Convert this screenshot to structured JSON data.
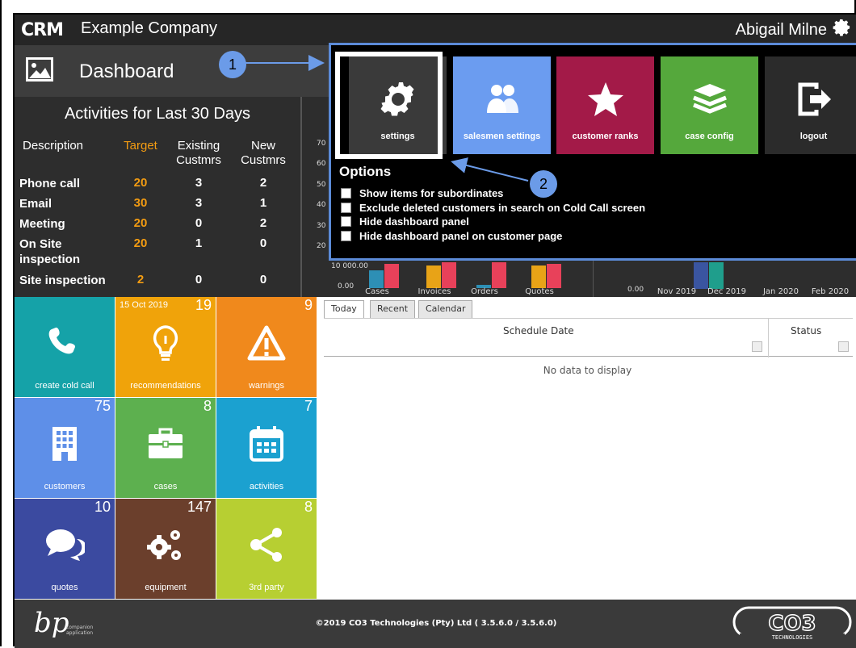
{
  "topbar": {
    "logo": "CRM",
    "company": "Example Company",
    "user": "Abigail Milne",
    "gear_icon": "gear-icon"
  },
  "titlebar": {
    "title": "Dashboard",
    "icon": "image-icon"
  },
  "activities": {
    "title": "Activities for Last 30 Days",
    "headers": {
      "description": "Description",
      "target": "Target",
      "existing": "Existing\nCustmrs",
      "new": "New\nCustmrs"
    },
    "rows": [
      {
        "description": "Phone call",
        "target": "20",
        "existing": "3",
        "new": "2"
      },
      {
        "description": "Email",
        "target": "30",
        "existing": "3",
        "new": "1"
      },
      {
        "description": "Meeting",
        "target": "20",
        "existing": "0",
        "new": "2"
      },
      {
        "description": "On Site\ninspection",
        "target": "20",
        "existing": "1",
        "new": "0"
      },
      {
        "description": "Site inspection",
        "target": "2",
        "existing": "0",
        "new": "0"
      }
    ]
  },
  "chart_data": [
    {
      "type": "bar",
      "categories": [
        "Cases",
        "Invoices",
        "Orders",
        "Quotes"
      ],
      "y_tick_labels": [
        "70",
        "60",
        "50",
        "40",
        "30",
        "20",
        "10 000.00",
        "0.00"
      ],
      "series_colors": [
        "#2d8fb5",
        "#e8a317",
        "#e8415a"
      ]
    },
    {
      "type": "bar",
      "categories": [
        "Nov 2019",
        "Dec 2019",
        "Jan 2020",
        "Feb 2020"
      ],
      "y_tick_labels": [
        "0.00"
      ],
      "series_colors": [
        "#3a55a0",
        "#1f9e8c"
      ]
    }
  ],
  "tiles": [
    {
      "label": "create cold call",
      "count": "",
      "date": "",
      "color": "#15a2a8",
      "icon": "phone-icon"
    },
    {
      "label": "recommendations",
      "count": "19",
      "date": "15 Oct 2019",
      "color": "#f0a30a",
      "icon": "lightbulb-icon"
    },
    {
      "label": "warnings",
      "count": "9",
      "date": "",
      "color": "#f0891c",
      "icon": "warning-icon"
    },
    {
      "label": "customers",
      "count": "75",
      "date": "",
      "color": "#5e8fe8",
      "icon": "building-icon"
    },
    {
      "label": "cases",
      "count": "8",
      "date": "",
      "color": "#5db04f",
      "icon": "briefcase-icon"
    },
    {
      "label": "activities",
      "count": "7",
      "date": "",
      "color": "#1ba1d0",
      "icon": "calendar-icon"
    },
    {
      "label": "quotes",
      "count": "10",
      "date": "",
      "color": "#3b4aa0",
      "icon": "chat-icon"
    },
    {
      "label": "equipment",
      "count": "147",
      "date": "",
      "color": "#6b3f2c",
      "icon": "gears-icon"
    },
    {
      "label": "3rd party",
      "count": "8",
      "date": "",
      "color": "#b7cf32",
      "icon": "share-icon"
    }
  ],
  "schedule": {
    "tabs": [
      "Today",
      "Recent",
      "Calendar"
    ],
    "columns": [
      "Schedule Date",
      "Status"
    ],
    "empty_text": "No data to display"
  },
  "footer": {
    "copyright": "©2019 CO3 Technologies (Pty) Ltd ( 3.5.6.0 / 3.5.6.0)",
    "left_logo": "bp",
    "left_logo_sub": "companion application",
    "right_logo": "CO3",
    "right_logo_sub": "TECHNOLOGIES"
  },
  "menu": {
    "items": [
      {
        "label": "settings",
        "color": "#3a3a3a",
        "icon": "gear-icon"
      },
      {
        "label": "salesmen settings",
        "color": "#6b9cf0",
        "icon": "users-icon"
      },
      {
        "label": "customer ranks",
        "color": "#a31a48",
        "icon": "star-icon"
      },
      {
        "label": "case config",
        "color": "#55a83c",
        "icon": "layers-icon"
      },
      {
        "label": "logout",
        "color": "#2b2b2b",
        "icon": "logout-icon"
      }
    ],
    "options_title": "Options",
    "options": [
      "Show items for subordinates",
      "Exclude deleted customers in search on Cold Call screen",
      "Hide dashboard panel",
      "Hide dashboard panel on customer page"
    ]
  },
  "callouts": [
    "1",
    "2"
  ]
}
